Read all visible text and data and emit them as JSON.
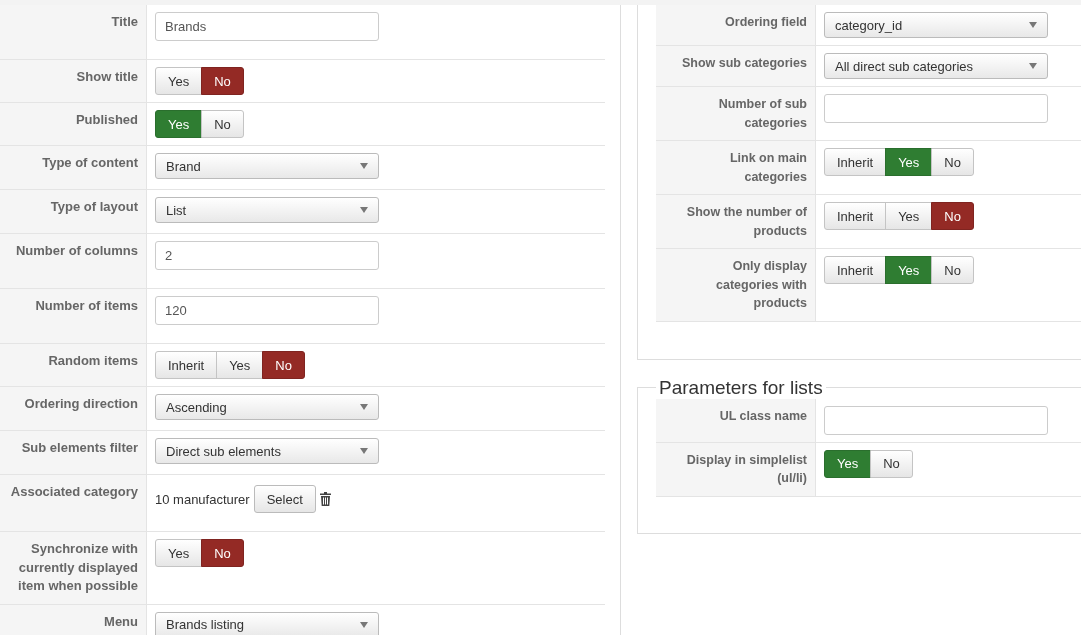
{
  "left_panel": {
    "rows": [
      {
        "label": "Title",
        "kind": "text",
        "value": "Brands"
      },
      {
        "label": "Show title",
        "kind": "toggle",
        "options": [
          {
            "label": "Yes",
            "selected": false
          },
          {
            "label": "No",
            "kind": "no",
            "selected": true
          }
        ]
      },
      {
        "label": "Published",
        "kind": "toggle",
        "options": [
          {
            "label": "Yes",
            "kind": "yes",
            "selected": true
          },
          {
            "label": "No",
            "selected": false
          }
        ]
      },
      {
        "label": "Type of content",
        "kind": "select",
        "value": "Brand"
      },
      {
        "label": "Type of layout",
        "kind": "select",
        "value": "List"
      },
      {
        "label": "Number of columns",
        "kind": "text",
        "value": "2"
      },
      {
        "label": "Number of items",
        "kind": "text",
        "value": "120"
      },
      {
        "label": "Random items",
        "kind": "toggle",
        "options": [
          {
            "label": "Inherit",
            "selected": false
          },
          {
            "label": "Yes",
            "selected": false
          },
          {
            "label": "No",
            "kind": "no",
            "selected": true
          }
        ]
      },
      {
        "label": "Ordering direction",
        "kind": "select",
        "value": "Ascending"
      },
      {
        "label": "Sub elements filter",
        "kind": "select",
        "value": "Direct sub elements"
      },
      {
        "label": "Associated category",
        "kind": "category",
        "value": "10 manufacturer",
        "button": "Select"
      },
      {
        "label": "Synchronize with currently displayed item when possible",
        "kind": "toggle",
        "options": [
          {
            "label": "Yes",
            "selected": false
          },
          {
            "label": "No",
            "kind": "no",
            "selected": true
          }
        ]
      },
      {
        "label": "Menu",
        "kind": "select",
        "value": "Brands listing"
      }
    ]
  },
  "right_panel": {
    "rows": [
      {
        "label": "Ordering field",
        "kind": "select",
        "value": "category_id"
      },
      {
        "label": "Show sub categories",
        "kind": "select",
        "value": "All direct sub categories"
      },
      {
        "label": "Number of sub categories",
        "kind": "text",
        "value": ""
      },
      {
        "label": "Link on main categories",
        "kind": "toggle",
        "options": [
          {
            "label": "Inherit",
            "selected": false
          },
          {
            "label": "Yes",
            "kind": "yes",
            "selected": true
          },
          {
            "label": "No",
            "selected": false
          }
        ]
      },
      {
        "label": "Show the number of products",
        "kind": "toggle",
        "options": [
          {
            "label": "Inherit",
            "selected": false
          },
          {
            "label": "Yes",
            "selected": false
          },
          {
            "label": "No",
            "kind": "no",
            "selected": true
          }
        ]
      },
      {
        "label": "Only display categories with products",
        "kind": "toggle",
        "options": [
          {
            "label": "Inherit",
            "selected": false
          },
          {
            "label": "Yes",
            "kind": "yes",
            "selected": true
          },
          {
            "label": "No",
            "selected": false
          }
        ]
      }
    ]
  },
  "lists_section": {
    "legend": "Parameters for lists",
    "rows": [
      {
        "label": "UL class name",
        "kind": "text",
        "value": ""
      },
      {
        "label": "Display in simplelist (ul/li)",
        "kind": "toggle",
        "options": [
          {
            "label": "Yes",
            "kind": "yes",
            "selected": true
          },
          {
            "label": "No",
            "selected": false
          }
        ]
      }
    ]
  }
}
